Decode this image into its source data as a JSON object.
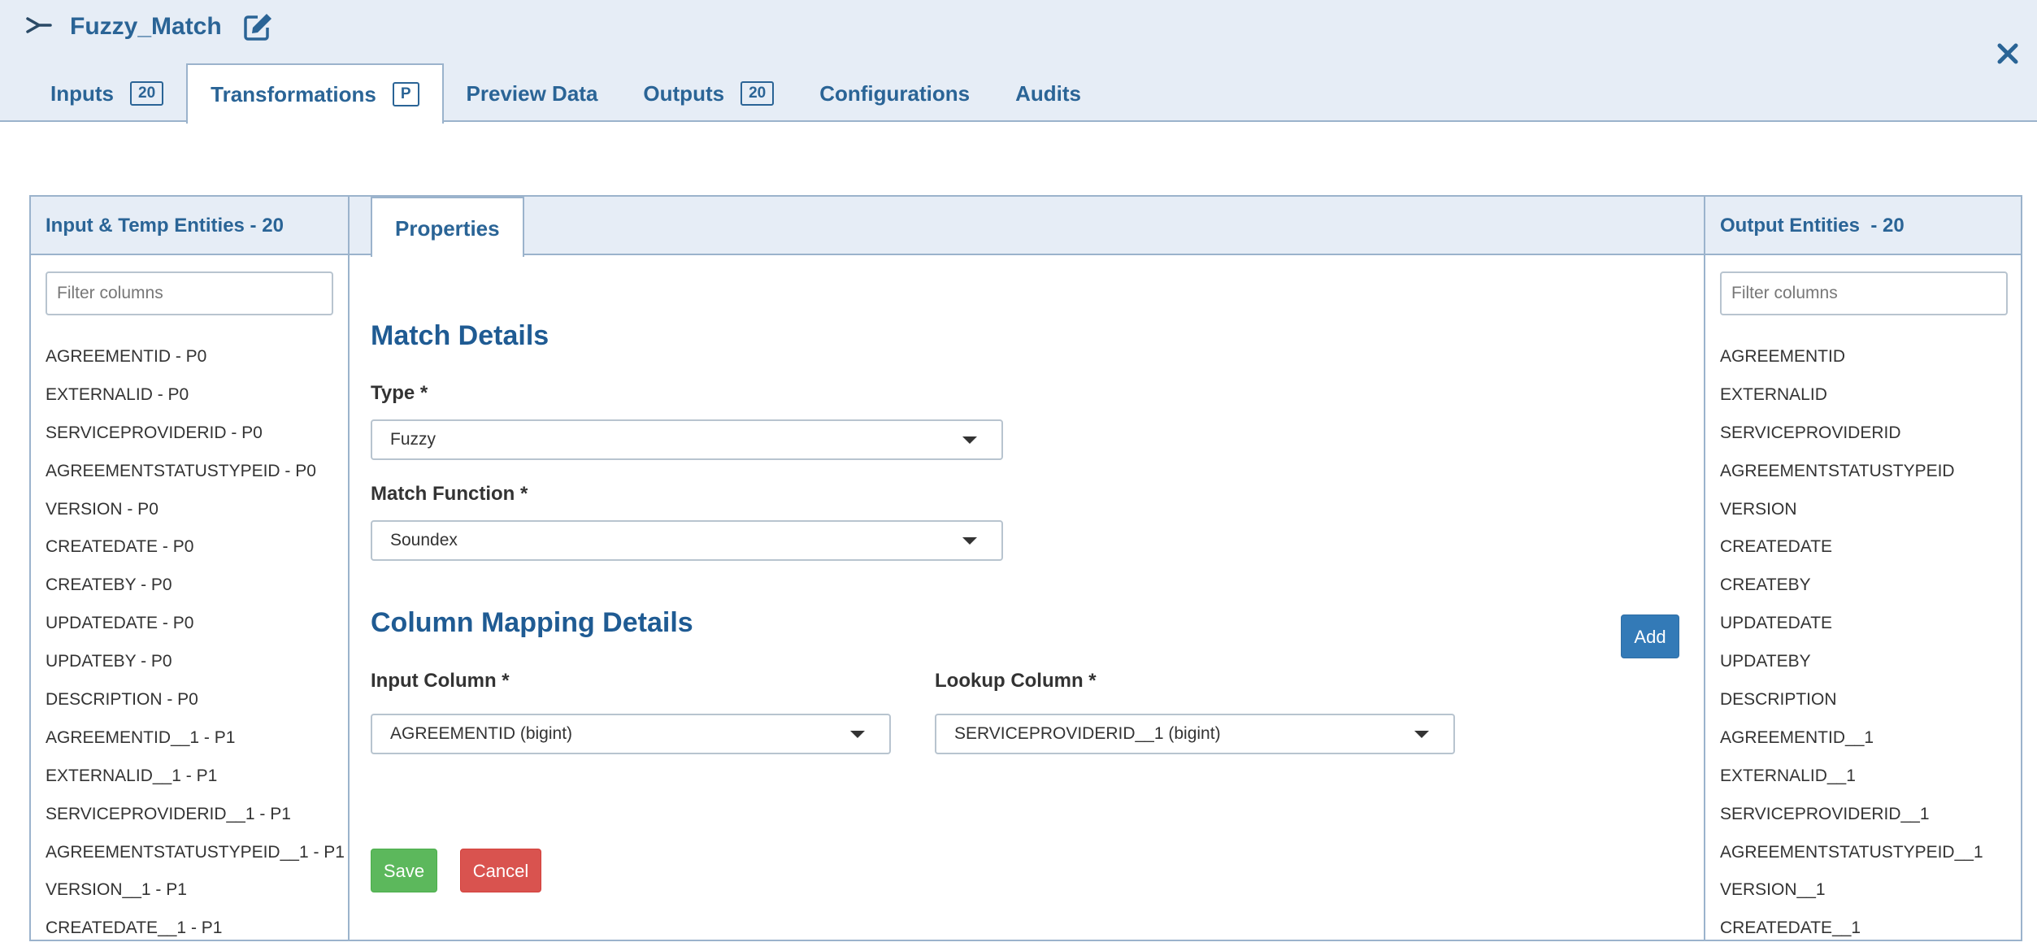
{
  "header": {
    "title": "Fuzzy_Match",
    "tabs": [
      {
        "label": "Inputs",
        "badge": "20"
      },
      {
        "label": "Transformations",
        "badge": "P"
      },
      {
        "label": "Preview Data"
      },
      {
        "label": "Outputs",
        "badge": "20"
      },
      {
        "label": "Configurations"
      },
      {
        "label": "Audits"
      }
    ],
    "active_tab": "Transformations"
  },
  "left_panel": {
    "title": "Input & Temp Entities - 20",
    "filter_placeholder": "Filter columns",
    "items": [
      "AGREEMENTID - P0",
      "EXTERNALID - P0",
      "SERVICEPROVIDERID - P0",
      "AGREEMENTSTATUSTYPEID - P0",
      "VERSION - P0",
      "CREATEDATE - P0",
      "CREATEBY - P0",
      "UPDATEDATE - P0",
      "UPDATEBY - P0",
      "DESCRIPTION - P0",
      "AGREEMENTID__1 - P1",
      "EXTERNALID__1 - P1",
      "SERVICEPROVIDERID__1 - P1",
      "AGREEMENTSTATUSTYPEID__1 - P1",
      "VERSION__1 - P1",
      "CREATEDATE__1 - P1"
    ]
  },
  "middle_panel": {
    "tab": "Properties",
    "match_details": {
      "heading": "Match Details",
      "type_label": "Type *",
      "type_value": "Fuzzy",
      "function_label": "Match Function *",
      "function_value": "Soundex"
    },
    "column_mapping": {
      "heading": "Column Mapping Details",
      "add_label": "Add",
      "input_label": "Input Column *",
      "input_value": "AGREEMENTID (bigint)",
      "lookup_label": "Lookup Column *",
      "lookup_value": "SERVICEPROVIDERID__1 (bigint)"
    },
    "save_label": "Save",
    "cancel_label": "Cancel"
  },
  "right_panel": {
    "title": "Output Entities  - 20",
    "filter_placeholder": "Filter columns",
    "items": [
      "AGREEMENTID",
      "EXTERNALID",
      "SERVICEPROVIDERID",
      "AGREEMENTSTATUSTYPEID",
      "VERSION",
      "CREATEDATE",
      "CREATEBY",
      "UPDATEDATE",
      "UPDATEBY",
      "DESCRIPTION",
      "AGREEMENTID__1",
      "EXTERNALID__1",
      "SERVICEPROVIDERID__1",
      "AGREEMENTSTATUSTYPEID__1",
      "VERSION__1",
      "CREATEDATE__1"
    ]
  },
  "colors": {
    "accent": "#2a6496",
    "header_bg": "#e6edf6",
    "border": "#9bb3cc",
    "add": "#337ab7",
    "save": "#5cb85c",
    "cancel": "#d9534f"
  }
}
